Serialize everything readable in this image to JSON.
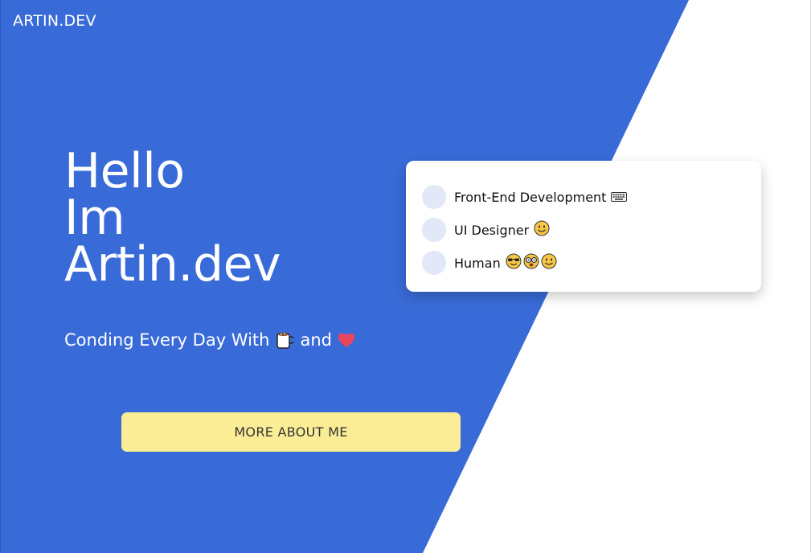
{
  "brand": "ARTIN.DEV",
  "hero": {
    "line1": "Hello",
    "line2": "Im",
    "line3": "Artin.dev"
  },
  "tagline": {
    "prefix": "Conding Every Day With",
    "middle": "and",
    "icons": [
      "coffee-mug-icon",
      "heart-icon"
    ]
  },
  "cta_label": "MORE ABOUT ME",
  "skills": [
    {
      "label": "Front-End Development",
      "icons": [
        "keyboard-icon"
      ]
    },
    {
      "label": "UI Designer",
      "icons": [
        "smiley-icon"
      ]
    },
    {
      "label": "Human",
      "icons": [
        "sunglasses-face-icon",
        "nerd-face-icon",
        "smiley-icon"
      ]
    }
  ],
  "colors": {
    "primary_blue": "#396bd8",
    "button_yellow": "#fbed96",
    "heart_red": "#e8455f",
    "skill_dot": "#e2e8f8"
  }
}
